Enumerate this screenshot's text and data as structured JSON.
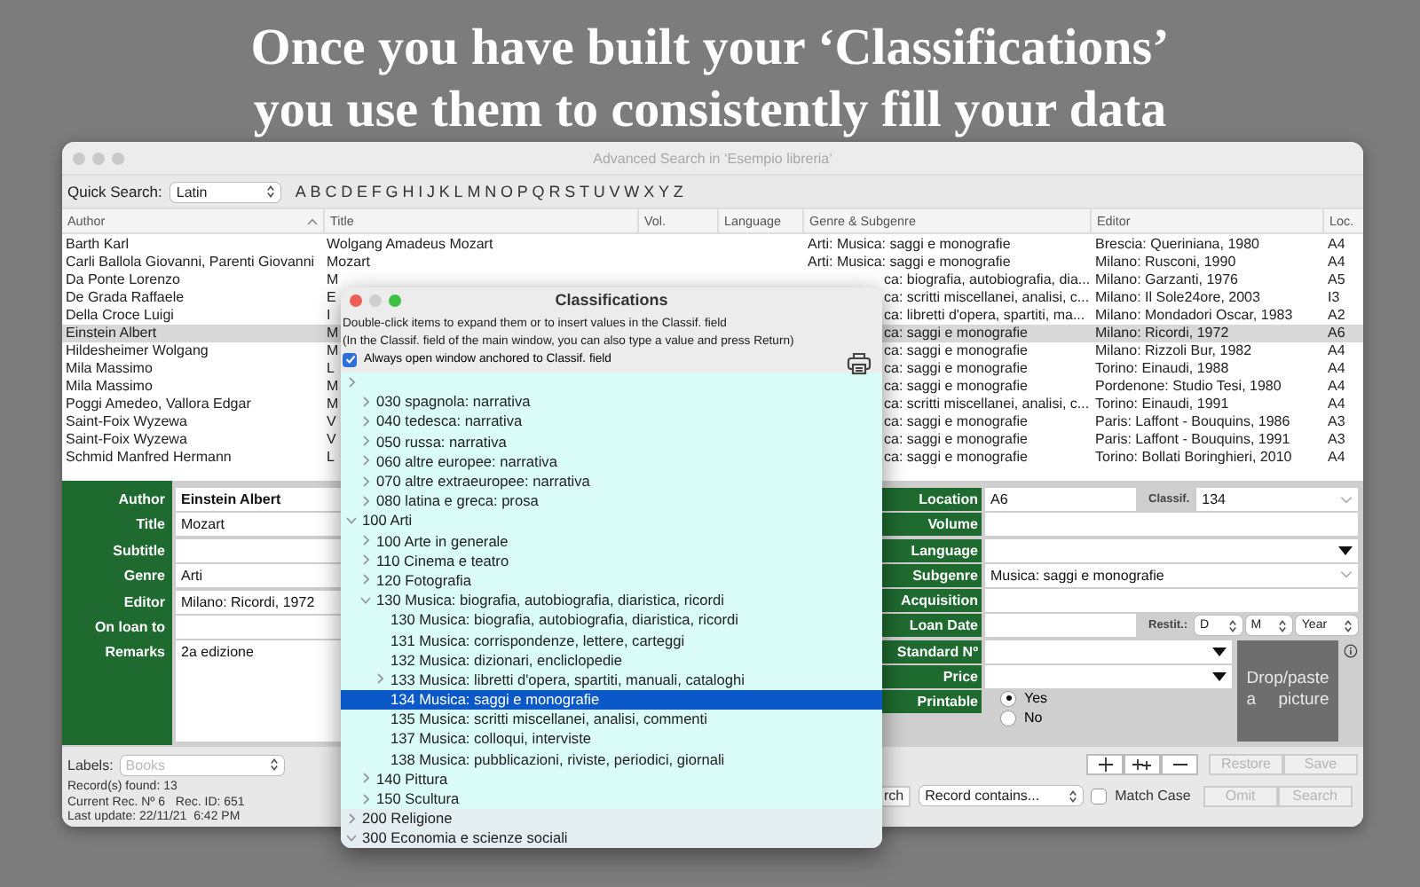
{
  "headline": [
    "Once you have built your ‘Classifications’",
    "you use them to consistently fill your data"
  ],
  "window": {
    "title": "Advanced Search in ‘Esempio libreria’"
  },
  "quick_search": {
    "label": "Quick Search:",
    "script": "Latin",
    "letters": [
      "A",
      "B",
      "C",
      "D",
      "E",
      "F",
      "G",
      "H",
      "I",
      "J",
      "K",
      "L",
      "M",
      "N",
      "O",
      "P",
      "Q",
      "R",
      "S",
      "T",
      "U",
      "V",
      "W",
      "X",
      "Y",
      "Z"
    ]
  },
  "table": {
    "columns": [
      {
        "label": "Author",
        "sorted": true
      },
      {
        "label": "Title",
        "sorted": false
      },
      {
        "label": "Vol.",
        "sorted": false
      },
      {
        "label": "Language",
        "sorted": false
      },
      {
        "label": "Genre & Subgenre",
        "sorted": false
      },
      {
        "label": "Editor",
        "sorted": false
      },
      {
        "label": "Loc.",
        "sorted": false
      }
    ],
    "rows": [
      {
        "author": "Barth Karl",
        "title": "Wolgang Amadeus Mozart",
        "genre": "Arti: Musica: saggi e monografie",
        "editor": "Brescia: Queriniana, 1980",
        "loc": "A4",
        "selected": false
      },
      {
        "author": "Carli Ballola Giovanni, Parenti Giovanni",
        "title": "Mozart",
        "genre": "Arti: Musica: saggi e monografie",
        "editor": "Milano: Rusconi, 1990",
        "loc": "A4",
        "selected": false
      },
      {
        "author": "Da Ponte Lorenzo",
        "title": "M",
        "genre": "ca: biografia, autobiografia, dia...",
        "editor": "Milano: Garzanti, 1976",
        "loc": "A5",
        "selected": false
      },
      {
        "author": "De Grada Raffaele",
        "title": "E",
        "genre": "ca: scritti miscellanei, analisi, c...",
        "editor": "Milano: Il Sole24ore, 2003",
        "loc": "I3",
        "selected": false
      },
      {
        "author": "Della Croce Luigi",
        "title": "I",
        "genre": "ca: libretti d'opera, spartiti, ma...",
        "editor": "Milano: Mondadori Oscar, 1983",
        "loc": "A2",
        "selected": false
      },
      {
        "author": "Einstein Albert",
        "title": "M",
        "genre": "ca: saggi e monografie",
        "editor": "Milano: Ricordi, 1972",
        "loc": "A6",
        "selected": true
      },
      {
        "author": "Hildesheimer Wolgang",
        "title": "M",
        "genre": "ca: saggi e monografie",
        "editor": "Milano: Rizzoli Bur, 1982",
        "loc": "A4",
        "selected": false
      },
      {
        "author": "Mila Massimo",
        "title": "L",
        "genre": "ca: saggi e monografie",
        "editor": "Torino: Einaudi, 1988",
        "loc": "A4",
        "selected": false
      },
      {
        "author": "Mila Massimo",
        "title": "M",
        "genre": "ca: saggi e monografie",
        "editor": "Pordenone: Studio Tesi, 1980",
        "loc": "A4",
        "selected": false
      },
      {
        "author": "Poggi Amedeo, Vallora Edgar",
        "title": "M",
        "genre": "ca: scritti miscellanei, analisi, c...",
        "editor": "Torino: Einaudi, 1991",
        "loc": "A4",
        "selected": false
      },
      {
        "author": "Saint-Foix Wyzewa",
        "title": "V",
        "genre": "ca: saggi e monografie",
        "editor": "Paris: Laffont - Bouquins, 1986",
        "loc": "A3",
        "selected": false
      },
      {
        "author": "Saint-Foix Wyzewa",
        "title": "V",
        "genre": "ca: saggi e monografie",
        "editor": "Paris: Laffont - Bouquins, 1991",
        "loc": "A3",
        "selected": false
      },
      {
        "author": "Schmid Manfred Hermann",
        "title": "L",
        "genre": "ca: saggi e monografie",
        "editor": "Torino: Bollati Boringhieri, 2010",
        "loc": "A4",
        "selected": false
      }
    ]
  },
  "form_left": [
    {
      "kind": "text",
      "label": "Author",
      "value": "Einstein Albert"
    },
    {
      "kind": "text",
      "label": "Title",
      "value": "Mozart"
    },
    {
      "kind": "text",
      "label": "Subtitle"
    },
    {
      "kind": "text",
      "label": "Genre",
      "value": "Arti"
    },
    {
      "kind": "text",
      "label": "Editor",
      "value": "Milano: Ricordi, 1972"
    },
    {
      "kind": "text",
      "label": "On loan to"
    },
    {
      "kind": "memo",
      "label": "Remarks",
      "value": "2a edizione"
    }
  ],
  "form_right": {
    "rows": [
      {
        "kind": "location",
        "label": "Location",
        "value": "A6",
        "classif_label": "Classif.",
        "classif_value": "134"
      },
      {
        "kind": "text",
        "label": "Volume"
      },
      {
        "kind": "popup",
        "label": "Language"
      },
      {
        "kind": "combo",
        "label": "Subgenre",
        "value": "Musica: saggi e monografie"
      },
      {
        "kind": "text",
        "label": "Acquisition"
      },
      {
        "kind": "date",
        "label": "Loan Date",
        "restit_label": "Restit.:",
        "day": "D",
        "month": "M",
        "year": "Year"
      }
    ],
    "side_rows": [
      {
        "kind": "popup",
        "label": "Standard Nº"
      },
      {
        "kind": "popup",
        "label": "Price"
      },
      {
        "kind": "radio",
        "label": "Printable",
        "options": [
          {
            "label": "Yes",
            "selected": true
          },
          {
            "label": "No",
            "selected": false
          }
        ]
      }
    ],
    "picture_drop": {
      "text": "Drop/paste a picture"
    }
  },
  "labels_bar": {
    "label": "Labels:",
    "value": "Books",
    "disabled": true
  },
  "status": [
    "Record(s) found: 13",
    "Current Rec. Nº 6   Rec. ID: 651",
    "Last update: 22/11/21  6:42 PM"
  ],
  "record_buttons": [
    {
      "label": "Restore",
      "disabled": true
    },
    {
      "label": "Save",
      "disabled": true
    }
  ],
  "search_bar": {
    "partial_button": "rch",
    "mode": "Record contains...",
    "match_case": {
      "label": "Match Case",
      "checked": false
    },
    "buttons": [
      {
        "label": "Omit",
        "disabled": true
      },
      {
        "label": "Search",
        "disabled": true
      }
    ]
  },
  "classifications": {
    "title": "Classifications",
    "help": [
      "Double-click items to expand them or to insert values in the Classif. field",
      "(In the Classif. field of the main window, you can also type a value and press Return)"
    ],
    "anchor_option": {
      "label": "Always open window anchored to Classif. field",
      "checked": true
    },
    "tree": [
      {
        "expanded": false,
        "highlighted": true,
        "children": [
          {
            "label": "030 spagnola: narrativa",
            "expanded": false,
            "selected": false
          },
          {
            "label": "040 tedesca: narrativa",
            "expanded": false,
            "selected": false
          },
          {
            "label": "050 russa: narrativa",
            "expanded": false,
            "selected": false
          },
          {
            "label": "060 altre europee: narrativa",
            "expanded": false,
            "selected": false
          },
          {
            "label": "070 altre extraeuropee: narrativa",
            "expanded": false,
            "selected": false
          },
          {
            "label": "080 latina e greca: prosa",
            "expanded": false,
            "selected": false
          }
        ]
      },
      {
        "label": "100 Arti",
        "expanded": true,
        "highlighted": true,
        "selected": false,
        "children": [
          {
            "label": "100 Arte in generale",
            "expanded": false,
            "selected": false
          },
          {
            "label": "110 Cinema e teatro",
            "expanded": false,
            "selected": false
          },
          {
            "label": "120 Fotografia",
            "expanded": false,
            "selected": false
          },
          {
            "label": "130 Musica: biografia, autobiografia, diaristica, ricordi",
            "expanded": true,
            "selected": false,
            "children": [
              {
                "label": "130 Musica: biografia, autobiografia, diaristica, ricordi",
                "selected": false
              },
              {
                "label": "131 Musica: corrispondenze, lettere, carteggi",
                "selected": false
              },
              {
                "label": "132 Musica: dizionari, encliclopedie",
                "selected": false
              },
              {
                "label": "133 Musica: libretti d'opera, spartiti, manuali, cataloghi",
                "expanded": false,
                "selected": false
              },
              {
                "label": "134 Musica: saggi e monografie",
                "selected": true
              },
              {
                "label": "135 Musica: scritti miscellanei, analisi, commenti",
                "selected": false
              },
              {
                "label": "137 Musica: colloqui, interviste",
                "selected": false
              },
              {
                "label": "138 Musica: pubblicazioni, riviste, periodici, giornali",
                "selected": false
              }
            ]
          },
          {
            "label": "140 Pittura",
            "expanded": false,
            "selected": false
          },
          {
            "label": "150 Scultura",
            "expanded": false,
            "selected": false
          }
        ]
      },
      {
        "label": "200 Religione",
        "expanded": false,
        "highlighted": false,
        "selected": false
      },
      {
        "label": "300 Economia e scienze sociali",
        "expanded": true,
        "highlighted": false,
        "selected": false
      }
    ]
  }
}
